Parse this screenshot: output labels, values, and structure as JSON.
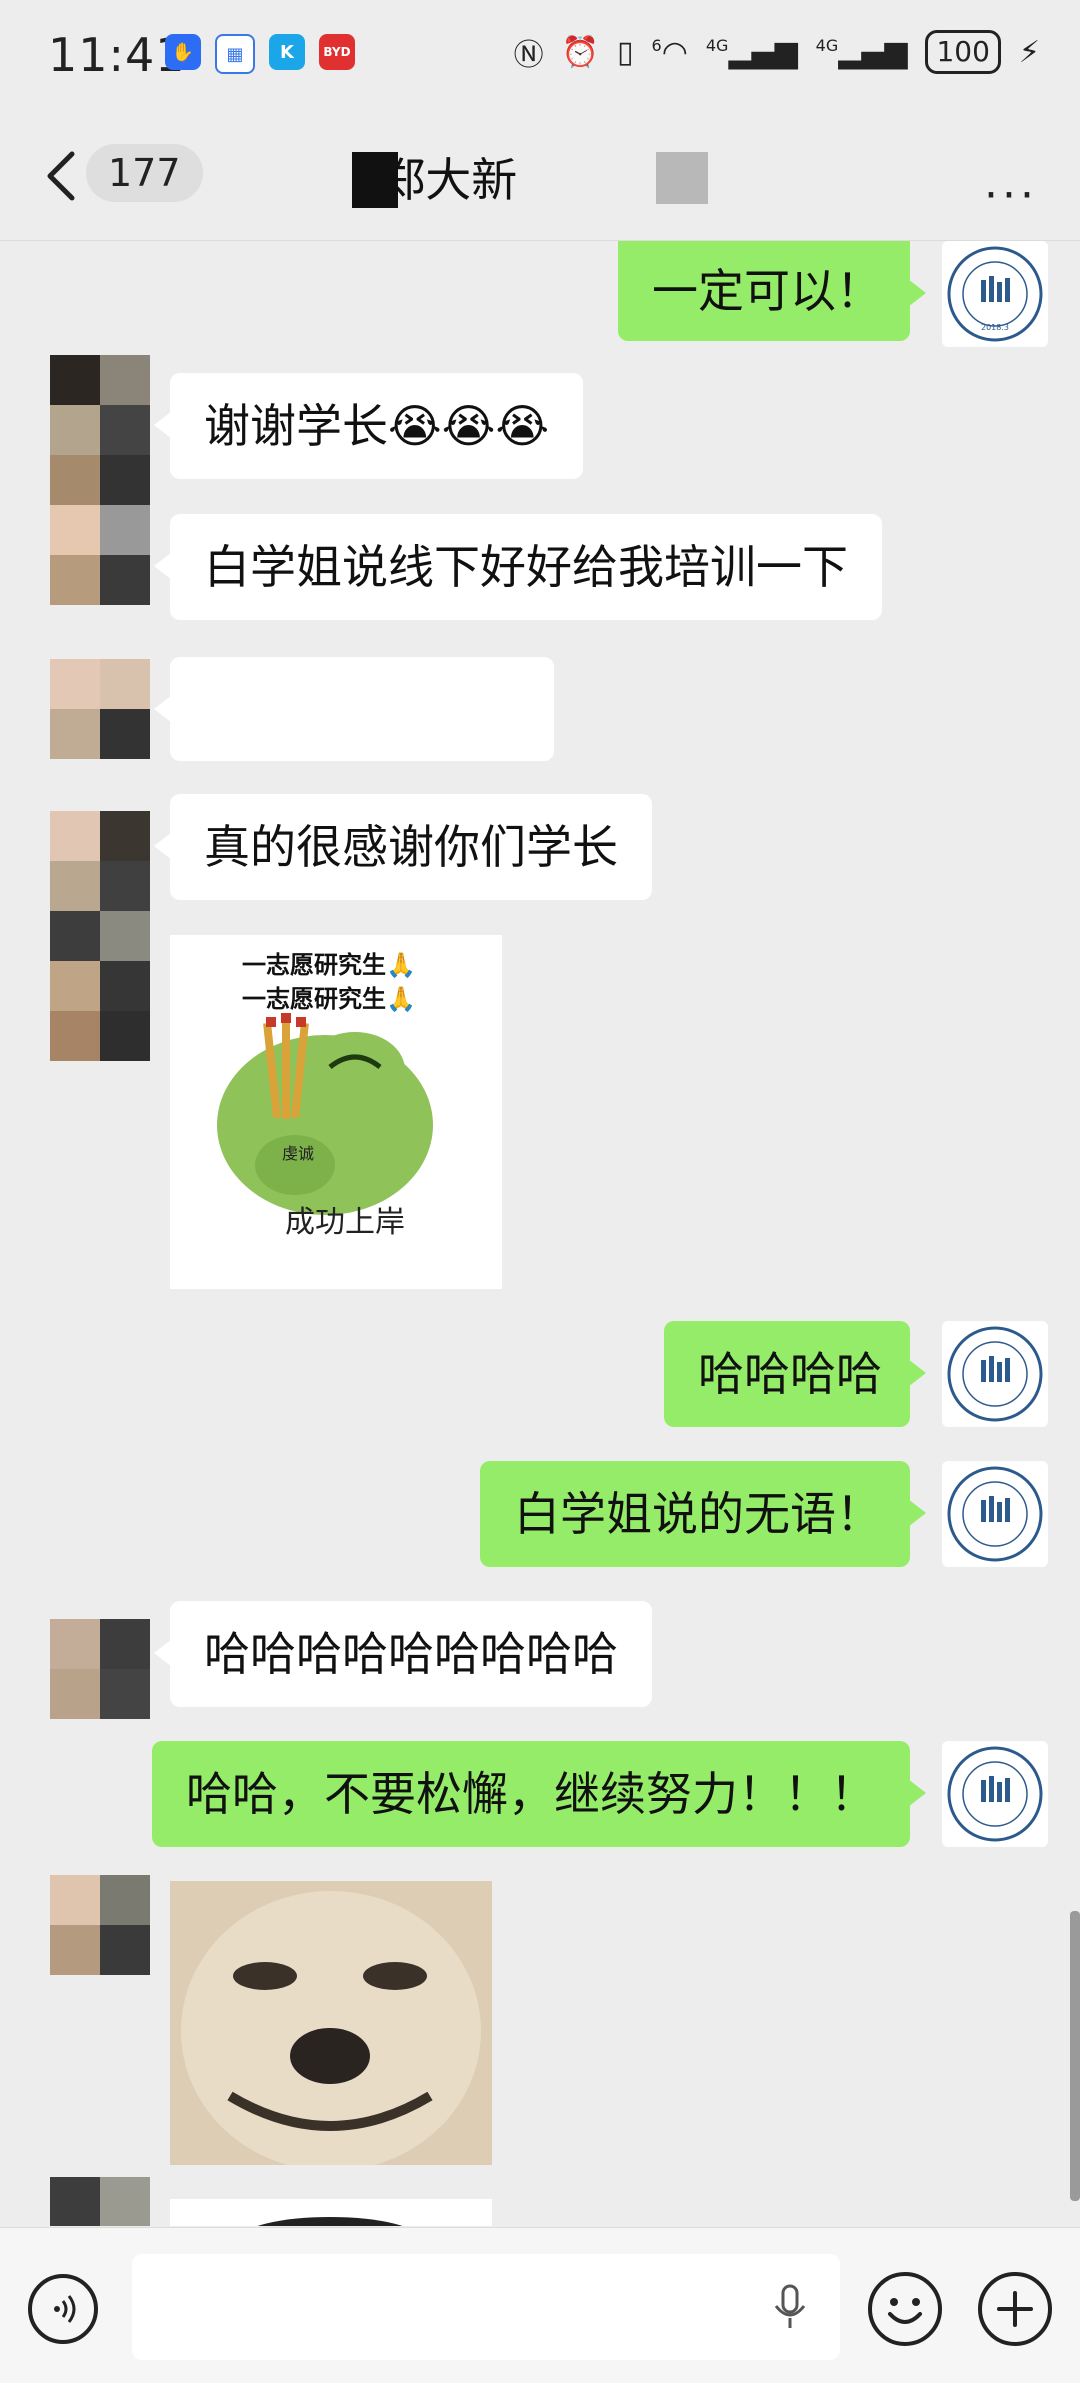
{
  "status_bar": {
    "time": "11:41",
    "network_1": "4G",
    "network_2": "4G",
    "wifi_badge": "6",
    "battery": "100"
  },
  "nav": {
    "unread_count": "177",
    "title": "6郑大新",
    "more": "···"
  },
  "messages": {
    "m1": "一定可以！",
    "m2": "谢谢学长😭😭😭",
    "m3": "白学姐说线下好好给我培训一下",
    "m4": "真的很感谢你们学长",
    "sticker1_line1": "一志愿研究生🙏",
    "sticker1_line2": "一志愿研究生🙏",
    "sticker1_tag": "虔诚",
    "sticker1_caption": "成功上岸",
    "m5": "哈哈哈哈",
    "m6": "白学姐说的无语！",
    "m7": "哈哈哈哈哈哈哈哈哈",
    "m8": "哈哈，不要松懈，继续努力！！！"
  },
  "avatar_logo": {
    "text_top": "LUO XUE ZHANG KAO YAN",
    "year": "2018.3"
  },
  "colors": {
    "bubble_green": "#95ec69",
    "background": "#ededed"
  },
  "input": {
    "placeholder": ""
  }
}
